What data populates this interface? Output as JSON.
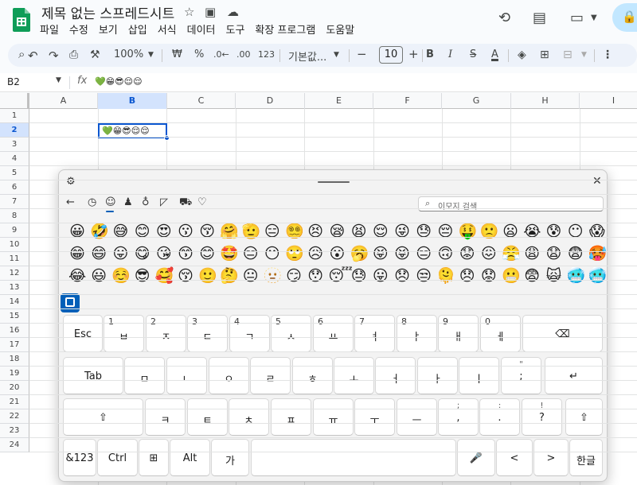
{
  "doc": {
    "title": "제목 없는 스프레드시트"
  },
  "menu": [
    "파일",
    "수정",
    "보기",
    "삽입",
    "서식",
    "데이터",
    "도구",
    "확장 프로그램",
    "도움말"
  ],
  "toolbar": {
    "zoom": "100%",
    "currency": "₩",
    "percent": "%",
    "dec_less": ".0←",
    "dec_more": ".00",
    "number_format": "123",
    "font": "기본값...",
    "font_size": "10",
    "bold": "B",
    "italic": "I",
    "strike": "S",
    "text_color": "A"
  },
  "formula_bar": {
    "cell_ref": "B2",
    "fx": "fx",
    "value": "💚😁😎😌😌"
  },
  "columns": [
    "A",
    "B",
    "C",
    "D",
    "E",
    "F",
    "G",
    "H",
    "I"
  ],
  "rows": [
    "1",
    "2",
    "3",
    "4",
    "5",
    "6",
    "7",
    "8",
    "9",
    "10",
    "11",
    "12",
    "13",
    "14",
    "15",
    "16",
    "17",
    "18",
    "19",
    "20",
    "21",
    "22",
    "23",
    "24"
  ],
  "selected_cell": {
    "ref": "B2",
    "content": "💚😁😎😌😌"
  },
  "emoji_panel": {
    "search_placeholder": "이모지 검색",
    "tabs": [
      "back-arrow-icon",
      "clock-icon",
      "smiley-icon",
      "people-icon",
      "lightbulb-icon",
      "wrench-icon",
      "car-icon",
      "heart-icon"
    ],
    "selected_tab": "smiley-icon",
    "emoji_rows": [
      [
        "😀",
        "🤣",
        "😅",
        "😊",
        "😍",
        "😗",
        "😚",
        "🤗",
        "🫡",
        "😑",
        "😵‍💫",
        "😣",
        "😪",
        "😫",
        "😌",
        "😜",
        "😓",
        "😔",
        "🤑",
        "🙁",
        "😦",
        "😭",
        "😰",
        "😶",
        "😱"
      ],
      [
        "😁",
        "😄",
        "😛",
        "😋",
        "😘",
        "😙",
        "😊",
        "🤩",
        "😑",
        "😶",
        "🙄",
        "😥",
        "😮",
        "🥱",
        "😝",
        "😝",
        "😑",
        "🙃",
        "😟",
        "😖",
        "😤",
        "😩",
        "😧",
        "😨",
        "🥵"
      ],
      [
        "😂",
        "😃",
        "☺️",
        "😎",
        "🥰",
        "😚",
        "🙂",
        "🤔",
        "😐",
        "🫥",
        "😏",
        "😯",
        "😴",
        "😓",
        "😛",
        "😞",
        "😒",
        "🫠",
        "😞",
        "😟",
        "😬",
        "😨",
        "🙀",
        "🥶",
        "🥶"
      ]
    ]
  },
  "keyboard": {
    "row1": [
      {
        "label": "Esc",
        "num": ""
      },
      {
        "label": "ㅂ",
        "num": "1"
      },
      {
        "label": "ㅈ",
        "num": "2"
      },
      {
        "label": "ㄷ",
        "num": "3"
      },
      {
        "label": "ㄱ",
        "num": "4"
      },
      {
        "label": "ㅅ",
        "num": "5"
      },
      {
        "label": "ㅛ",
        "num": "6"
      },
      {
        "label": "ㅕ",
        "num": "7"
      },
      {
        "label": "ㅑ",
        "num": "8"
      },
      {
        "label": "ㅐ",
        "num": "9"
      },
      {
        "label": "ㅔ",
        "num": "0"
      },
      {
        "label": "⌫",
        "num": ""
      }
    ],
    "row2": [
      {
        "label": "Tab"
      },
      {
        "label": "ㅁ"
      },
      {
        "label": "ㄴ"
      },
      {
        "label": "ㅇ"
      },
      {
        "label": "ㄹ"
      },
      {
        "label": "ㅎ"
      },
      {
        "label": "ㅗ"
      },
      {
        "label": "ㅓ"
      },
      {
        "label": "ㅏ"
      },
      {
        "label": "ㅣ"
      },
      {
        "label": ";",
        "top": "\""
      },
      {
        "label": "↵"
      }
    ],
    "row3": [
      {
        "label": "⇧"
      },
      {
        "label": "ㅋ"
      },
      {
        "label": "ㅌ"
      },
      {
        "label": "ㅊ"
      },
      {
        "label": "ㅍ"
      },
      {
        "label": "ㅠ"
      },
      {
        "label": "ㅜ"
      },
      {
        "label": "ㅡ"
      },
      {
        "label": ",",
        "top": ";"
      },
      {
        "label": ".",
        "top": ":"
      },
      {
        "label": "?",
        "top": "!"
      },
      {
        "label": "⇧"
      }
    ],
    "row4": [
      {
        "label": "&123"
      },
      {
        "label": "Ctrl"
      },
      {
        "label": "⊞"
      },
      {
        "label": "Alt"
      },
      {
        "label": "가"
      },
      {
        "label": ""
      },
      {
        "label": "🎤"
      },
      {
        "label": "<"
      },
      {
        "label": ">"
      },
      {
        "label": "한글"
      }
    ]
  }
}
